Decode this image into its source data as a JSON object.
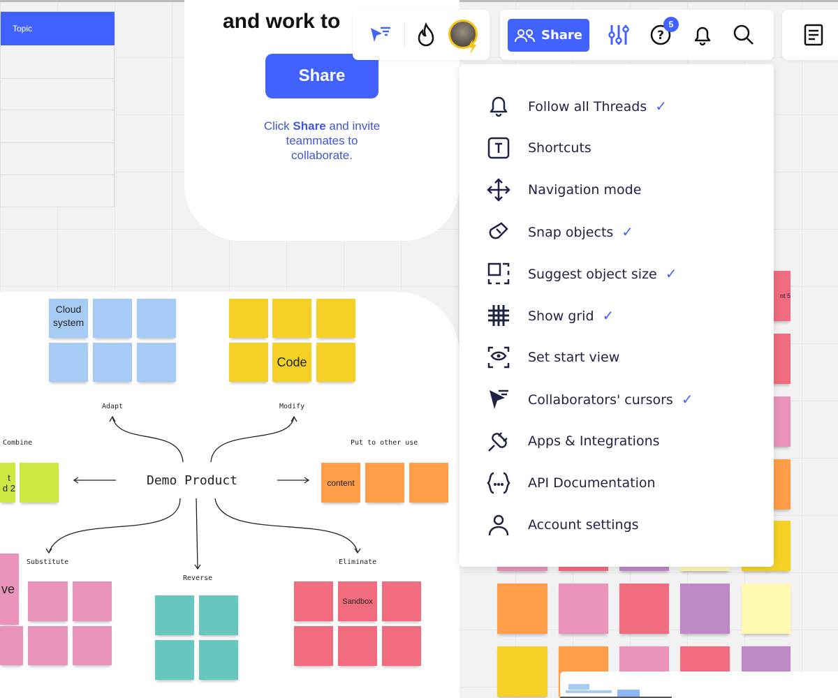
{
  "table": {
    "header": "Topic"
  },
  "invite_card": {
    "title": "and work to",
    "button": "Share",
    "text_pre": "Click ",
    "text_bold": "Share",
    "text_post": " and invite teammates to collaborate."
  },
  "toolbar": {
    "share_label": "Share",
    "help_badge": "5",
    "icons": [
      "cursor-filter-icon",
      "flame-icon",
      "avatar",
      "people-icon",
      "sliders-icon",
      "help-icon",
      "bell-icon",
      "search-icon",
      "notes-icon"
    ]
  },
  "menu": {
    "items": [
      {
        "label": "Follow all Threads",
        "icon": "bell-icon",
        "checked": true
      },
      {
        "label": "Shortcuts",
        "icon": "keyboard-key-icon",
        "checked": false
      },
      {
        "label": "Navigation mode",
        "icon": "move-arrows-icon",
        "checked": false
      },
      {
        "label": "Snap objects",
        "icon": "magnet-icon",
        "checked": true
      },
      {
        "label": "Suggest object size",
        "icon": "resize-frame-icon",
        "checked": true
      },
      {
        "label": "Show grid",
        "icon": "grid-icon",
        "checked": true
      },
      {
        "label": "Set start view",
        "icon": "eye-frame-icon",
        "checked": false
      },
      {
        "label": "Collaborators' cursors",
        "icon": "cursor-icon",
        "checked": true
      },
      {
        "label": "Apps & Integrations",
        "icon": "plug-icon",
        "checked": false
      },
      {
        "label": "API Documentation",
        "icon": "braces-icon",
        "checked": false
      },
      {
        "label": "Account settings",
        "icon": "user-icon",
        "checked": false
      }
    ],
    "check": "✓"
  },
  "mindmap": {
    "center": "Demo Product",
    "branches": {
      "adapt": "Adapt",
      "modify": "Modify",
      "combine": "Combine",
      "put": "Put to other use",
      "substitute": "Substitute",
      "reverse": "Reverse",
      "eliminate": "Eliminate"
    },
    "notes": {
      "cloud": "Cloud system",
      "code": "Code",
      "lime": "t\nd 2",
      "content": "content",
      "pink": "ve",
      "sandbox": "Sandbox",
      "right": "nt 5"
    }
  },
  "colors": {
    "accent": "#4262ff",
    "blue": "#a6ccf5",
    "yellow": "#f5d128",
    "lime": "#cee741",
    "orange": "#ff9d48",
    "pink": "#ea94bb",
    "teal": "#67c6c0",
    "red": "#f16c7f",
    "purple": "#be88c7",
    "lightyellow": "#fff9b1"
  }
}
